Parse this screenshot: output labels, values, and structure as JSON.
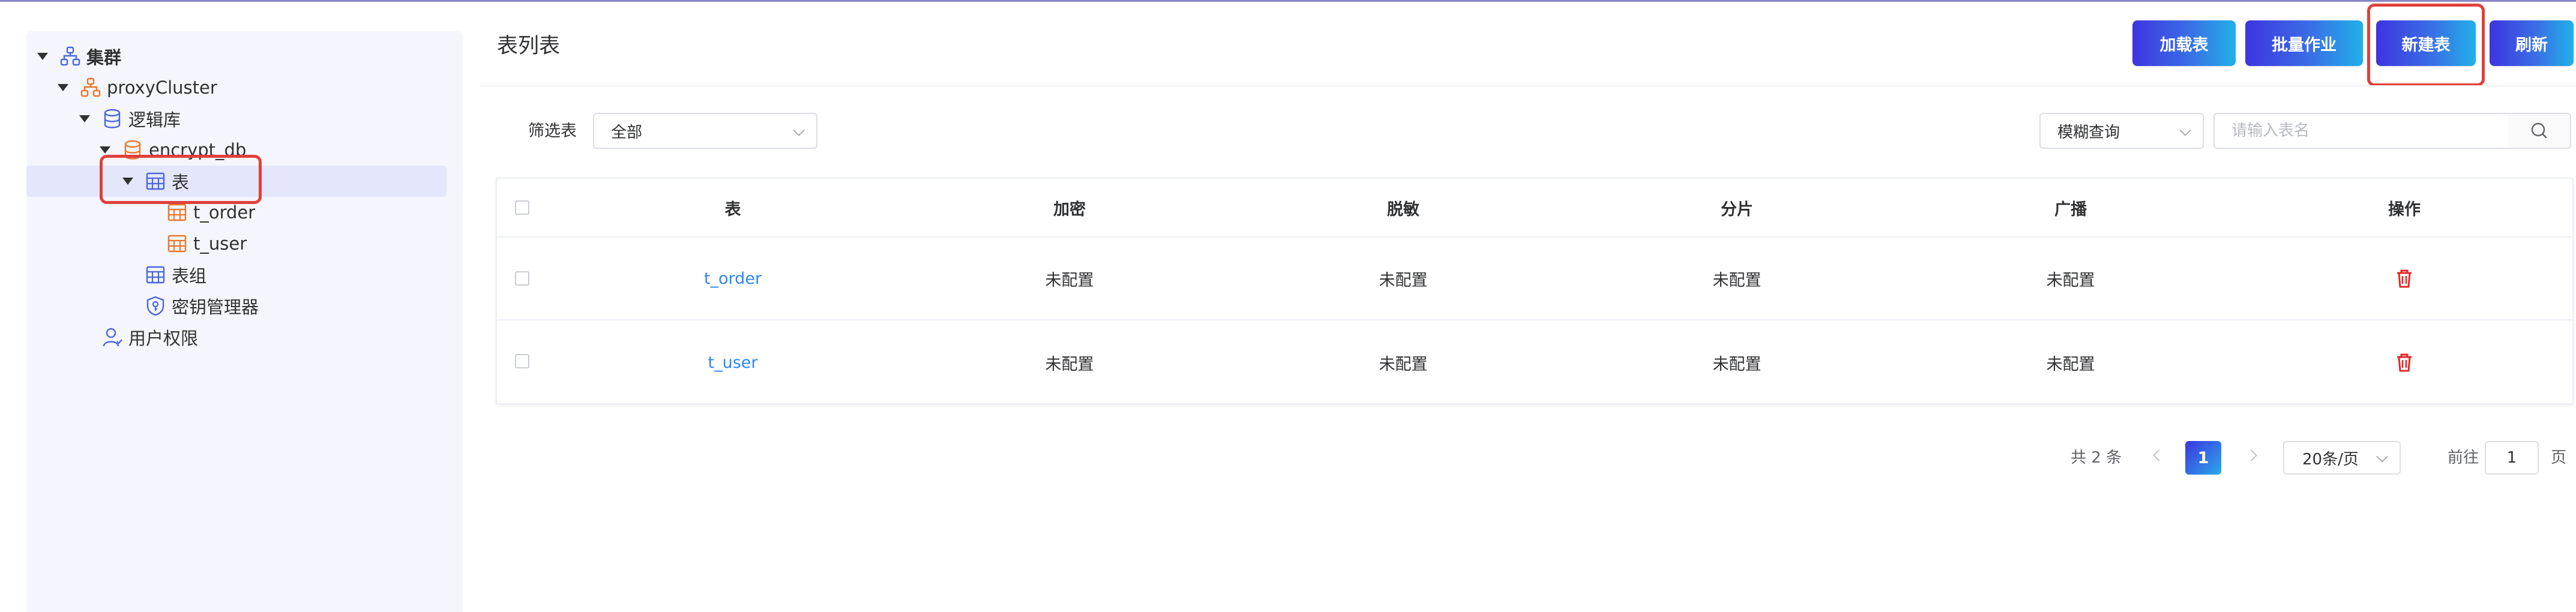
{
  "sidebar": {
    "tree": [
      {
        "label": "集群",
        "icon": "cluster-icon"
      },
      {
        "label": "proxyCluster",
        "icon": "proxy-cluster-icon"
      },
      {
        "label": "逻辑库",
        "icon": "database-icon"
      },
      {
        "label": "encrypt_db",
        "icon": "database-icon"
      },
      {
        "label": "表",
        "icon": "table-icon"
      },
      {
        "label": "t_order",
        "icon": "table-icon"
      },
      {
        "label": "t_user",
        "icon": "table-icon"
      },
      {
        "label": "表组",
        "icon": "table-group-icon"
      },
      {
        "label": "密钥管理器",
        "icon": "key-manager-icon"
      },
      {
        "label": "用户权限",
        "icon": "user-icon"
      }
    ]
  },
  "header": {
    "title": "表列表",
    "buttons": [
      "加载表",
      "批量作业",
      "新建表",
      "刷新"
    ]
  },
  "filter": {
    "label": "筛选表",
    "value": "全部",
    "query_mode": "模糊查询",
    "search_placeholder": "请输入表名"
  },
  "table": {
    "columns": [
      "表",
      "加密",
      "脱敏",
      "分片",
      "广播",
      "操作"
    ],
    "rows": [
      {
        "name": "t_order",
        "encrypt": "未配置",
        "mask": "未配置",
        "shard": "未配置",
        "broadcast": "未配置"
      },
      {
        "name": "t_user",
        "encrypt": "未配置",
        "mask": "未配置",
        "shard": "未配置",
        "broadcast": "未配置"
      }
    ]
  },
  "pagination": {
    "total": "共 2 条",
    "current_page": "1",
    "page_size": "20条/页",
    "goto_label": "前往",
    "goto_value": "1",
    "page_suffix": "页"
  },
  "colors": {
    "accent": "#3d35e0",
    "link": "#2e86f5",
    "danger": "#e02929",
    "highlight": "#e0403a",
    "sidebar_bg": "#f5f6fd"
  }
}
